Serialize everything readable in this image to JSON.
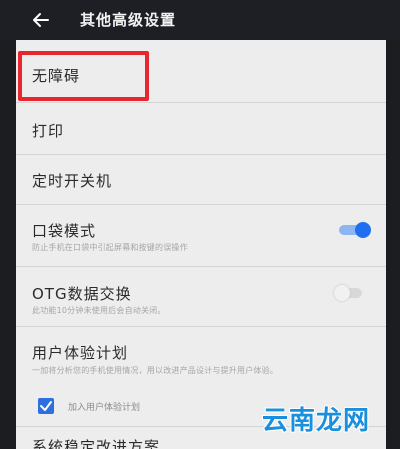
{
  "header": {
    "title": "其他高级设置",
    "back_icon": "back-arrow-icon"
  },
  "items": [
    {
      "label": "无障碍"
    },
    {
      "label": "打印"
    },
    {
      "label": "定时开关机"
    },
    {
      "label": "口袋模式",
      "description": "防止手机在口袋中引起屏幕和按键的误操作",
      "toggle": true
    },
    {
      "label": "OTG数据交换",
      "description": "此功能10分钟未使用后会自动关闭。",
      "toggle": false
    },
    {
      "label": "用户体验计划",
      "description": "一加将分析您的手机使用情况，用以改进产品设计与提升用户体验。",
      "checkbox_label": "加入用户体验计划",
      "checkbox_checked": true
    },
    {
      "label": "系统稳定改进方案"
    }
  ],
  "colors": {
    "accent": "#1f6ff0",
    "highlight": "#e8262d",
    "watermark": "#1a8fdd"
  },
  "watermark": "云南龙网"
}
